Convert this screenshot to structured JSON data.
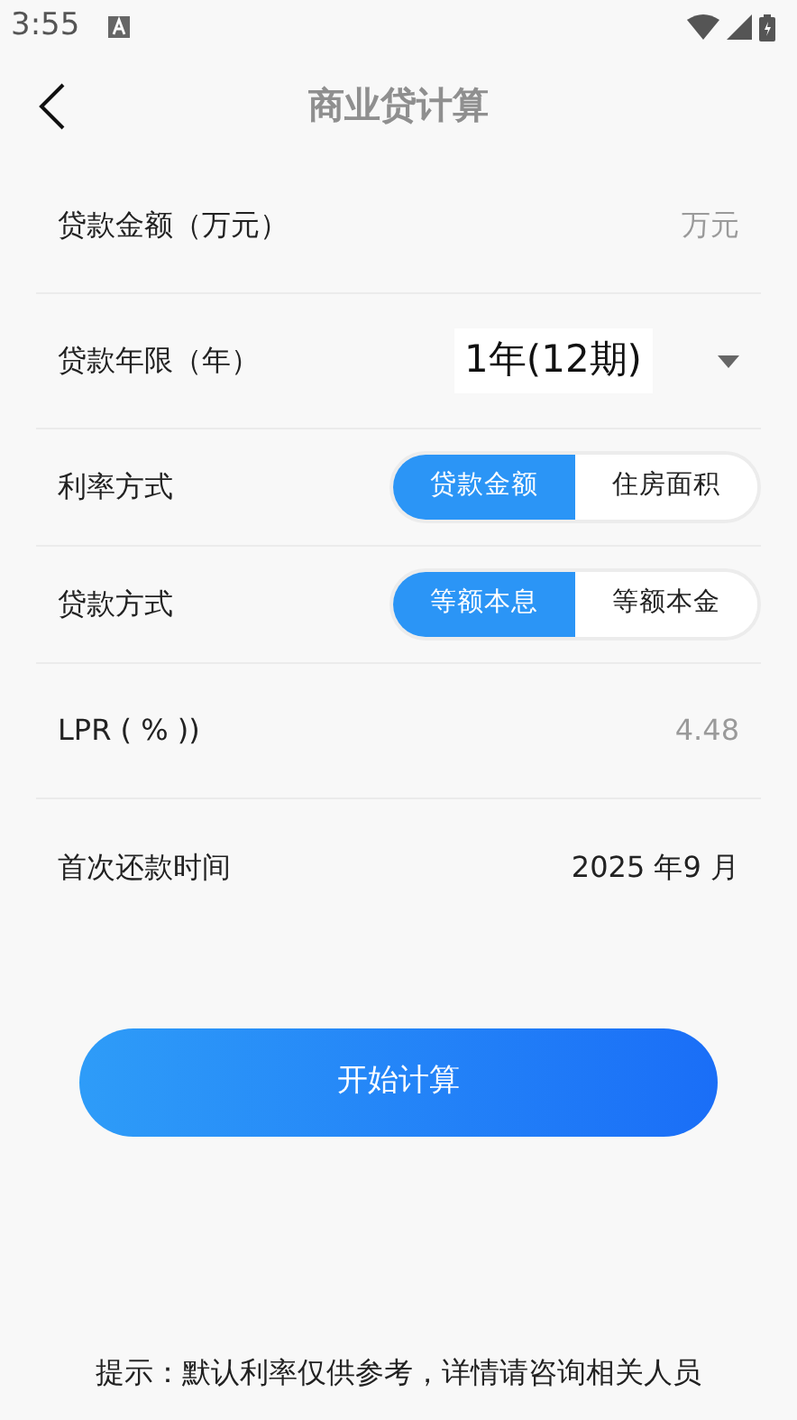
{
  "status_bar": {
    "time": "3:55"
  },
  "header": {
    "title": "商业贷计算"
  },
  "form": {
    "rows": [
      {
        "kind": "input",
        "label": "贷款金额（万元）",
        "placeholder": "万元"
      },
      {
        "kind": "select",
        "label": "贷款年限（年）",
        "value": "1年(12期)"
      },
      {
        "kind": "segmented",
        "label": "利率方式",
        "options": [
          {
            "label": "贷款金额",
            "selected": true
          },
          {
            "label": "住房面积",
            "selected": false
          }
        ]
      },
      {
        "kind": "segmented",
        "label": "贷款方式",
        "options": [
          {
            "label": "等额本息",
            "selected": true
          },
          {
            "label": "等额本金",
            "selected": false
          }
        ]
      },
      {
        "kind": "input",
        "label": "LPR ( % ))",
        "placeholder": "4.48"
      },
      {
        "kind": "text",
        "label": "首次还款时间",
        "value": "2025 年9 月"
      }
    ]
  },
  "button": "开始计算",
  "footer": "提示：默认利率仅供参考，详情请咨询相关人员"
}
